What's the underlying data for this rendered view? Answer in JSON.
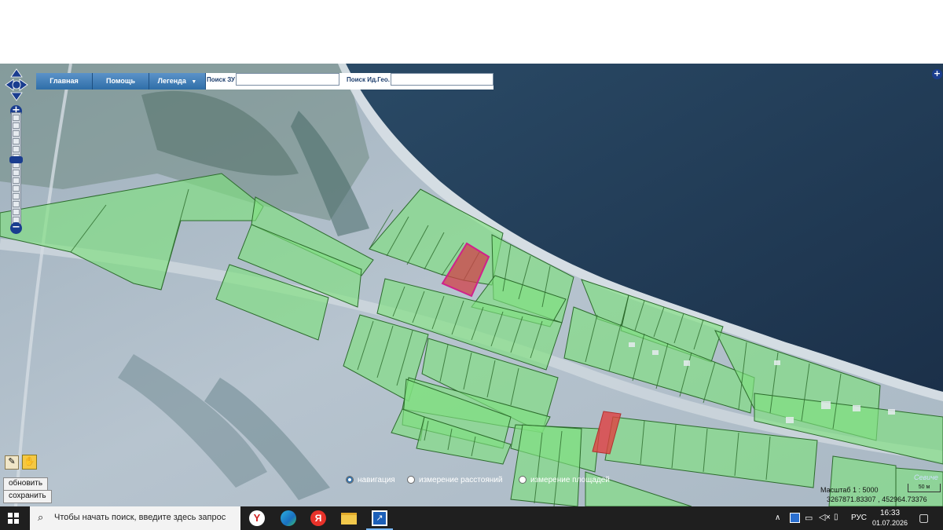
{
  "toolbar": {
    "buttons": [
      {
        "label": "Главная"
      },
      {
        "label": "Помощь"
      },
      {
        "label": "Легенда"
      }
    ],
    "search_zu_label": "Поиск ЗУ",
    "search_zu_value": "",
    "search_id_label": "Поиск Ид.Гео.",
    "search_id_value": ""
  },
  "map": {
    "scale_label": "Масштаб 1 : 5000",
    "scale_bar_label": "50 м",
    "coordinates": "3267871.83307 , 452964.73376",
    "brand": "Севиче",
    "parcel_fill": "#7fe07f",
    "selected_parcel_color": "#d0208c",
    "highlight_parcel_color": "#e04040",
    "water_color": "#1d3550"
  },
  "side_controls": {
    "refresh_label": "обновить",
    "save_label": "сохранить"
  },
  "modes": {
    "navigation": "навигация",
    "distance": "измерение расстояний",
    "area": "измерение площадей"
  },
  "taskbar": {
    "search_placeholder": "Чтобы начать поиск, введите здесь запрос",
    "language": "РУС",
    "time": "16:33",
    "date": "01.07.2026"
  }
}
